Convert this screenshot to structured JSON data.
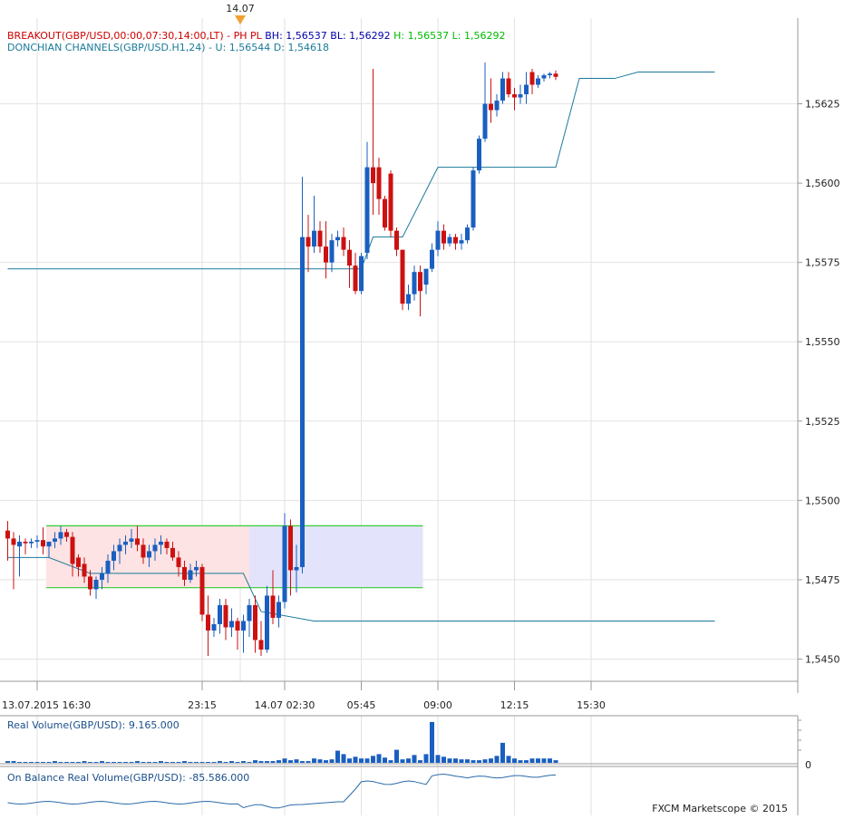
{
  "top_marker": "14.07",
  "indicator_lines": [
    {
      "name": "BREAKOUT(GBP/USD,00:00,07:30,14:00,LT)",
      "sep": "-",
      "items": [
        {
          "text": "PH",
          "color": "#cc0000"
        },
        {
          "text": "PL",
          "color": "#cc0000"
        },
        {
          "text": "BH: 1,56537",
          "color": "#0000aa"
        },
        {
          "text": "BL: 1,56292",
          "color": "#0000aa"
        },
        {
          "text": "H: 1,56537",
          "color": "#00bb00"
        },
        {
          "text": "L: 1,56292",
          "color": "#00bb00"
        }
      ],
      "name_color": "#cc0000"
    },
    {
      "name": "DONCHIAN CHANNELS(GBP/USD.H1,24)",
      "sep": "-",
      "items": [
        {
          "text": "U: 1,56544",
          "color": "#1a7a9a"
        },
        {
          "text": "D: 1,54618",
          "color": "#1a7a9a"
        }
      ],
      "name_color": "#1a7a9a"
    }
  ],
  "volume_label": "Real Volume(GBP/USD): 9.165.000",
  "obv_label": "On Balance Real Volume(GBP/USD): -85.586.000",
  "watermark": "FXCM Marketscope © 2015",
  "volume_zero": "0",
  "colors": {
    "up": "#1a5fc0",
    "down": "#cc1111",
    "donchian": "#1a7a9a",
    "range_line": "#33cc33",
    "pre_box": "#fde3e3",
    "post_box": "#e3e3fb",
    "grid": "#e2e2e2",
    "obv": "#2a6aa8"
  },
  "chart_data": {
    "type": "candlestick",
    "title": "",
    "symbol": "GBP/USD",
    "timeframe": "H1",
    "y_ticks": [
      "1,5450",
      "1,5475",
      "1,5500",
      "1,5525",
      "1,5550",
      "1,5575",
      "1,5600",
      "1,5625"
    ],
    "y_tick_values": [
      1.545,
      1.5475,
      1.55,
      1.5525,
      1.555,
      1.5575,
      1.56,
      1.5625
    ],
    "ylim": [
      1.5443,
      1.5652
    ],
    "x_ticks": [
      {
        "label": "13.07.2015 16:30",
        "index": 5
      },
      {
        "label": "23:15",
        "index": 33
      },
      {
        "label": "14.07 02:30",
        "index": 47
      },
      {
        "label": "05:45",
        "index": 60
      },
      {
        "label": "09:00",
        "index": 73
      },
      {
        "label": "12:15",
        "index": 86
      },
      {
        "label": "15:30",
        "index": 99
      }
    ],
    "candles": [
      {
        "o": 1.54905,
        "h": 1.54935,
        "l": 1.5481,
        "c": 1.5488
      },
      {
        "o": 1.5488,
        "h": 1.549,
        "l": 1.5472,
        "c": 1.5486
      },
      {
        "o": 1.54855,
        "h": 1.5489,
        "l": 1.5476,
        "c": 1.5487
      },
      {
        "o": 1.5487,
        "h": 1.5488,
        "l": 1.5483,
        "c": 1.54865
      },
      {
        "o": 1.54865,
        "h": 1.5488,
        "l": 1.5485,
        "c": 1.5487
      },
      {
        "o": 1.5487,
        "h": 1.5489,
        "l": 1.5485,
        "c": 1.54875
      },
      {
        "o": 1.54875,
        "h": 1.54915,
        "l": 1.5483,
        "c": 1.54855
      },
      {
        "o": 1.54855,
        "h": 1.5487,
        "l": 1.5482,
        "c": 1.5487
      },
      {
        "o": 1.5487,
        "h": 1.549,
        "l": 1.5485,
        "c": 1.5488
      },
      {
        "o": 1.5488,
        "h": 1.5492,
        "l": 1.5486,
        "c": 1.549
      },
      {
        "o": 1.549,
        "h": 1.5491,
        "l": 1.5487,
        "c": 1.54885
      },
      {
        "o": 1.54885,
        "h": 1.549,
        "l": 1.5476,
        "c": 1.548
      },
      {
        "o": 1.5482,
        "h": 1.5483,
        "l": 1.5476,
        "c": 1.5479
      },
      {
        "o": 1.548,
        "h": 1.5482,
        "l": 1.5474,
        "c": 1.5476
      },
      {
        "o": 1.5476,
        "h": 1.5478,
        "l": 1.547,
        "c": 1.5472
      },
      {
        "o": 1.5472,
        "h": 1.5476,
        "l": 1.5469,
        "c": 1.5475
      },
      {
        "o": 1.5475,
        "h": 1.5479,
        "l": 1.5472,
        "c": 1.5477
      },
      {
        "o": 1.5477,
        "h": 1.5483,
        "l": 1.5474,
        "c": 1.5481
      },
      {
        "o": 1.5481,
        "h": 1.5486,
        "l": 1.5478,
        "c": 1.5484
      },
      {
        "o": 1.5484,
        "h": 1.5488,
        "l": 1.548,
        "c": 1.5486
      },
      {
        "o": 1.5486,
        "h": 1.5489,
        "l": 1.5483,
        "c": 1.5487
      },
      {
        "o": 1.5487,
        "h": 1.5491,
        "l": 1.5485,
        "c": 1.5488
      },
      {
        "o": 1.5488,
        "h": 1.5492,
        "l": 1.5484,
        "c": 1.5486
      },
      {
        "o": 1.5486,
        "h": 1.5488,
        "l": 1.548,
        "c": 1.5482
      },
      {
        "o": 1.5482,
        "h": 1.5486,
        "l": 1.5479,
        "c": 1.5484
      },
      {
        "o": 1.5484,
        "h": 1.5488,
        "l": 1.5481,
        "c": 1.5486
      },
      {
        "o": 1.5486,
        "h": 1.5489,
        "l": 1.5483,
        "c": 1.5487
      },
      {
        "o": 1.5487,
        "h": 1.5488,
        "l": 1.5483,
        "c": 1.5485
      },
      {
        "o": 1.5485,
        "h": 1.5487,
        "l": 1.5481,
        "c": 1.5482
      },
      {
        "o": 1.5482,
        "h": 1.5484,
        "l": 1.5476,
        "c": 1.5479
      },
      {
        "o": 1.5479,
        "h": 1.5481,
        "l": 1.5473,
        "c": 1.5475
      },
      {
        "o": 1.5475,
        "h": 1.548,
        "l": 1.5474,
        "c": 1.5478
      },
      {
        "o": 1.5478,
        "h": 1.5481,
        "l": 1.5476,
        "c": 1.5479
      },
      {
        "o": 1.5479,
        "h": 1.548,
        "l": 1.5462,
        "c": 1.5464
      },
      {
        "o": 1.5464,
        "h": 1.547,
        "l": 1.5451,
        "c": 1.5459
      },
      {
        "o": 1.5459,
        "h": 1.5463,
        "l": 1.5457,
        "c": 1.5461
      },
      {
        "o": 1.5461,
        "h": 1.5469,
        "l": 1.5458,
        "c": 1.5467
      },
      {
        "o": 1.5467,
        "h": 1.5469,
        "l": 1.5456,
        "c": 1.546
      },
      {
        "o": 1.546,
        "h": 1.5466,
        "l": 1.5457,
        "c": 1.5462
      },
      {
        "o": 1.5462,
        "h": 1.5463,
        "l": 1.5453,
        "c": 1.5459
      },
      {
        "o": 1.5459,
        "h": 1.5464,
        "l": 1.5452,
        "c": 1.5462
      },
      {
        "o": 1.5462,
        "h": 1.5469,
        "l": 1.5457,
        "c": 1.5467
      },
      {
        "o": 1.5467,
        "h": 1.547,
        "l": 1.5452,
        "c": 1.5456
      },
      {
        "o": 1.5456,
        "h": 1.5462,
        "l": 1.5451,
        "c": 1.5453
      },
      {
        "o": 1.5453,
        "h": 1.5473,
        "l": 1.5452,
        "c": 1.547
      },
      {
        "o": 1.547,
        "h": 1.5478,
        "l": 1.5461,
        "c": 1.5463
      },
      {
        "o": 1.5463,
        "h": 1.547,
        "l": 1.546,
        "c": 1.5468
      },
      {
        "o": 1.5468,
        "h": 1.5496,
        "l": 1.5466,
        "c": 1.5492
      },
      {
        "o": 1.5492,
        "h": 1.5494,
        "l": 1.547,
        "c": 1.5478
      },
      {
        "o": 1.5478,
        "h": 1.5486,
        "l": 1.5471,
        "c": 1.5479
      },
      {
        "o": 1.5479,
        "h": 1.5602,
        "l": 1.5477,
        "c": 1.5583
      },
      {
        "o": 1.5583,
        "h": 1.559,
        "l": 1.5572,
        "c": 1.558
      },
      {
        "o": 1.558,
        "h": 1.5596,
        "l": 1.5578,
        "c": 1.5585
      },
      {
        "o": 1.5585,
        "h": 1.5588,
        "l": 1.5578,
        "c": 1.558
      },
      {
        "o": 1.558,
        "h": 1.5588,
        "l": 1.557,
        "c": 1.5575
      },
      {
        "o": 1.5575,
        "h": 1.5584,
        "l": 1.5572,
        "c": 1.5582
      },
      {
        "o": 1.5582,
        "h": 1.5585,
        "l": 1.558,
        "c": 1.5583
      },
      {
        "o": 1.5583,
        "h": 1.5586,
        "l": 1.5577,
        "c": 1.5579
      },
      {
        "o": 1.5579,
        "h": 1.5582,
        "l": 1.5567,
        "c": 1.5574
      },
      {
        "o": 1.5574,
        "h": 1.5578,
        "l": 1.5565,
        "c": 1.5566
      },
      {
        "o": 1.5566,
        "h": 1.5578,
        "l": 1.5565,
        "c": 1.5577
      },
      {
        "o": 1.5578,
        "h": 1.5613,
        "l": 1.5576,
        "c": 1.5605
      },
      {
        "o": 1.5605,
        "h": 1.5636,
        "l": 1.559,
        "c": 1.56
      },
      {
        "o": 1.5605,
        "h": 1.5608,
        "l": 1.559,
        "c": 1.5595
      },
      {
        "o": 1.5595,
        "h": 1.5596,
        "l": 1.5585,
        "c": 1.5586
      },
      {
        "o": 1.5603,
        "h": 1.5604,
        "l": 1.5583,
        "c": 1.5585
      },
      {
        "o": 1.5585,
        "h": 1.5586,
        "l": 1.5577,
        "c": 1.5579
      },
      {
        "o": 1.5579,
        "h": 1.5579,
        "l": 1.556,
        "c": 1.5562
      },
      {
        "o": 1.5562,
        "h": 1.5568,
        "l": 1.556,
        "c": 1.5565
      },
      {
        "o": 1.5565,
        "h": 1.5574,
        "l": 1.5563,
        "c": 1.5572
      },
      {
        "o": 1.5572,
        "h": 1.5574,
        "l": 1.5558,
        "c": 1.5566
      },
      {
        "o": 1.5568,
        "h": 1.5573,
        "l": 1.5565,
        "c": 1.5573
      },
      {
        "o": 1.5573,
        "h": 1.5581,
        "l": 1.5572,
        "c": 1.5579
      },
      {
        "o": 1.5579,
        "h": 1.5588,
        "l": 1.5577,
        "c": 1.5585
      },
      {
        "o": 1.5585,
        "h": 1.5587,
        "l": 1.5579,
        "c": 1.5581
      },
      {
        "o": 1.5581,
        "h": 1.5584,
        "l": 1.558,
        "c": 1.5583
      },
      {
        "o": 1.5583,
        "h": 1.5584,
        "l": 1.5579,
        "c": 1.5581
      },
      {
        "o": 1.5581,
        "h": 1.5584,
        "l": 1.5579,
        "c": 1.5582
      },
      {
        "o": 1.5582,
        "h": 1.5587,
        "l": 1.5581,
        "c": 1.5586
      },
      {
        "o": 1.5586,
        "h": 1.5605,
        "l": 1.5585,
        "c": 1.5604
      },
      {
        "o": 1.5604,
        "h": 1.5615,
        "l": 1.5603,
        "c": 1.5614
      },
      {
        "o": 1.5614,
        "h": 1.5638,
        "l": 1.5613,
        "c": 1.5625
      },
      {
        "o": 1.5625,
        "h": 1.5633,
        "l": 1.5619,
        "c": 1.5623
      },
      {
        "o": 1.5623,
        "h": 1.5628,
        "l": 1.5621,
        "c": 1.5626
      },
      {
        "o": 1.5626,
        "h": 1.5635,
        "l": 1.5625,
        "c": 1.5633
      },
      {
        "o": 1.5633,
        "h": 1.5635,
        "l": 1.5627,
        "c": 1.5628
      },
      {
        "o": 1.5628,
        "h": 1.563,
        "l": 1.5623,
        "c": 1.5627
      },
      {
        "o": 1.5627,
        "h": 1.5631,
        "l": 1.5625,
        "c": 1.5628
      },
      {
        "o": 1.5628,
        "h": 1.5635,
        "l": 1.5625,
        "c": 1.5631
      },
      {
        "o": 1.5635,
        "h": 1.5636,
        "l": 1.5628,
        "c": 1.5631
      },
      {
        "o": 1.5631,
        "h": 1.5634,
        "l": 1.563,
        "c": 1.5633
      },
      {
        "o": 1.5633,
        "h": 1.56345,
        "l": 1.5632,
        "c": 1.5634
      },
      {
        "o": 1.5634,
        "h": 1.5635,
        "l": 1.5633,
        "c": 1.56345
      },
      {
        "o": 1.56345,
        "h": 1.56355,
        "l": 1.56325,
        "c": 1.56335
      }
    ],
    "donchian_upper": [
      [
        0,
        1.5573
      ],
      [
        60,
        1.5573
      ],
      [
        62,
        1.5583
      ],
      [
        67,
        1.5583
      ],
      [
        73,
        1.5605
      ],
      [
        93,
        1.5605
      ],
      [
        97,
        1.5633
      ],
      [
        103,
        1.5633
      ],
      [
        107,
        1.5635
      ],
      [
        120,
        1.5635
      ]
    ],
    "donchian_lower": [
      [
        0,
        1.5482
      ],
      [
        7,
        1.5482
      ],
      [
        14,
        1.5477
      ],
      [
        40,
        1.5477
      ],
      [
        43,
        1.5465
      ],
      [
        52,
        1.5462
      ],
      [
        120,
        1.5462
      ]
    ],
    "breakout_box": {
      "high": 1.5492,
      "low": 1.54725,
      "pre_start": 7,
      "pre_end": 41,
      "post_end": 70
    },
    "volume": [
      1,
      1,
      1,
      1,
      1,
      1,
      1,
      1,
      1,
      1,
      1,
      1,
      1,
      1,
      1,
      1,
      1,
      1,
      1,
      1,
      1,
      1,
      1,
      1,
      1,
      1,
      1,
      1,
      1,
      1,
      1,
      1,
      1,
      1,
      1,
      1,
      1,
      1,
      1,
      1,
      1,
      1,
      1,
      1,
      1,
      1,
      1,
      1,
      1,
      1,
      1,
      1,
      1,
      1,
      1,
      1,
      1,
      1,
      1,
      1,
      1,
      1,
      1,
      1,
      1,
      1,
      1,
      1,
      1,
      1,
      1,
      1,
      1,
      1,
      1,
      1,
      1,
      1,
      1,
      1,
      1,
      1,
      1,
      1,
      1,
      1,
      1,
      1,
      1,
      1,
      1,
      1,
      1,
      1,
      1,
      1,
      1,
      1,
      1,
      1,
      1,
      1,
      1,
      1,
      1,
      1,
      1,
      1,
      1,
      1,
      1,
      1,
      1,
      1,
      1,
      1,
      1,
      1,
      1,
      1
    ]
  }
}
